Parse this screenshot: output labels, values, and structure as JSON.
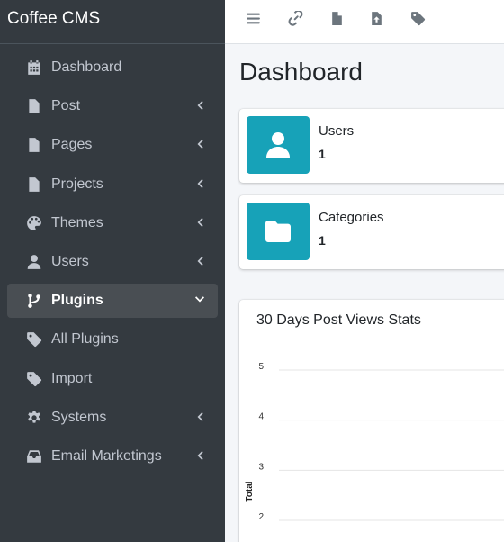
{
  "sidebar": {
    "brand": "Coffee CMS",
    "items": [
      {
        "label": "Dashboard",
        "icon": "calendar-icon",
        "arrow": ""
      },
      {
        "label": "Post",
        "icon": "file-icon",
        "arrow": "left"
      },
      {
        "label": "Pages",
        "icon": "file-icon",
        "arrow": "left"
      },
      {
        "label": "Projects",
        "icon": "file-icon",
        "arrow": "left"
      },
      {
        "label": "Themes",
        "icon": "palette-icon",
        "arrow": "left"
      },
      {
        "label": "Users",
        "icon": "user-icon",
        "arrow": "left"
      },
      {
        "label": "Plugins",
        "icon": "code-branch-icon",
        "arrow": "down",
        "active": true
      },
      {
        "label": "All Plugins",
        "icon": "tag-icon",
        "arrow": ""
      },
      {
        "label": "Import",
        "icon": "tag-icon",
        "arrow": ""
      },
      {
        "label": "Systems",
        "icon": "cog-icon",
        "arrow": "left"
      },
      {
        "label": "Email Marketings",
        "icon": "inbox-icon",
        "arrow": "left"
      }
    ]
  },
  "topbar": {
    "icons": [
      "menu-icon",
      "link-icon",
      "file-icon",
      "file-upload-icon",
      "tag-icon"
    ]
  },
  "main": {
    "title": "Dashboard",
    "info_boxes": [
      {
        "label": "Users",
        "value": "1",
        "icon": "user-icon"
      },
      {
        "label": "Categories",
        "value": "1",
        "icon": "folder-icon"
      }
    ],
    "chart_card_title": "30 Days Post Views Stats"
  },
  "colors": {
    "sidebar_bg": "#343a40",
    "accent": "#17a2b8",
    "active_item_bg": "#494e53"
  },
  "chart_data": {
    "type": "line",
    "title": "30 Days Post Views Stats",
    "ylabel": "Total",
    "xlabel": "",
    "yticks": [
      "5",
      "4",
      "3",
      "2"
    ],
    "ylim": [
      2,
      5
    ],
    "grid": true,
    "series": []
  }
}
